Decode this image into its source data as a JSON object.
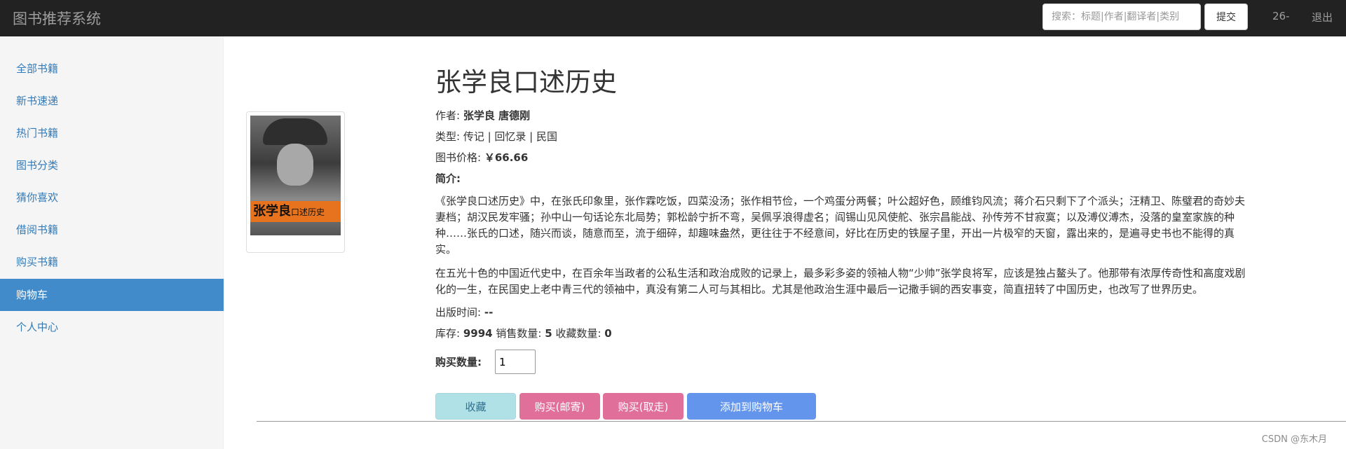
{
  "navbar": {
    "brand": "图书推荐系统",
    "search_placeholder": "搜索：标题|作者|翻译者|类别",
    "submit_label": "提交",
    "user_label": "26-",
    "logout_label": "退出"
  },
  "sidebar": {
    "items": [
      {
        "label": "全部书籍"
      },
      {
        "label": "新书速递"
      },
      {
        "label": "热门书籍"
      },
      {
        "label": "图书分类"
      },
      {
        "label": "猜你喜欢"
      },
      {
        "label": "借阅书籍"
      },
      {
        "label": "购买书籍"
      },
      {
        "label": "购物车",
        "active": true
      },
      {
        "label": "个人中心"
      }
    ]
  },
  "cover": {
    "title_text": "张学良",
    "subtitle_text": "口述历史"
  },
  "book": {
    "title": "张学良口述历史",
    "author_label": "作者:",
    "author_value": "张学良 唐德刚",
    "type_text": "类型: 传记 | 回忆录 | 民国",
    "price_label": "图书价格:",
    "price_value": "￥66.66",
    "intro_label": "简介:",
    "intro_p1": "《张学良口述历史》中，在张氏印象里，张作霖吃饭，四菜没汤；张作相节俭，一个鸡蛋分两餐；叶公超好色，顾维钧风流；蒋介石只剩下了个派头；汪精卫、陈璧君的奇妙夫妻档；胡汉民发牢骚；孙中山一句话论东北局势；郭松龄宁折不弯，吴佩孚浪得虚名；阎锡山见风使舵、张宗昌能战、孙传芳不甘寂寞；以及溥仪溥杰，没落的皇室家族的种种……张氏的口述，随兴而谈，随意而至，流于细碎，却趣味盎然，更往往于不经意间，好比在历史的铁屋子里，开出一片极窄的天窗，露出来的，是遍寻史书也不能得的真实。",
    "intro_p2": "在五光十色的中国近代史中，在百余年当政者的公私生活和政治成败的记录上，最多彩多姿的领袖人物“少帅”张学良将军，应该是独占鳌头了。他那带有浓厚传奇性和高度戏剧化的一生，在民国史上老中青三代的领袖中，真没有第二人可与其相比。尤其是他政治生涯中最后一记撒手锏的西安事变，简直扭转了中国历史，也改写了世界历史。",
    "publish_label": "出版时间:",
    "publish_value": "--",
    "stock_label": "库存:",
    "stock_value": "9994",
    "sales_label": "销售数量:",
    "sales_value": "5",
    "fav_label": "收藏数量:",
    "fav_value": "0",
    "qty_label": "购买数量:",
    "qty_value": "1"
  },
  "actions": {
    "favorite": "收藏",
    "buy_mail": "购买(邮寄)",
    "buy_pickup": "购买(取走)",
    "add_cart": "添加到购物车"
  },
  "footer": {
    "watermark": "CSDN @东木月"
  },
  "colors": {
    "navbar_bg": "#222222",
    "sidebar_active": "#428bca",
    "link": "#337ab7",
    "btn_info": "#b0e1e6",
    "btn_pink": "#e0709a",
    "btn_blue": "#6495ed"
  }
}
